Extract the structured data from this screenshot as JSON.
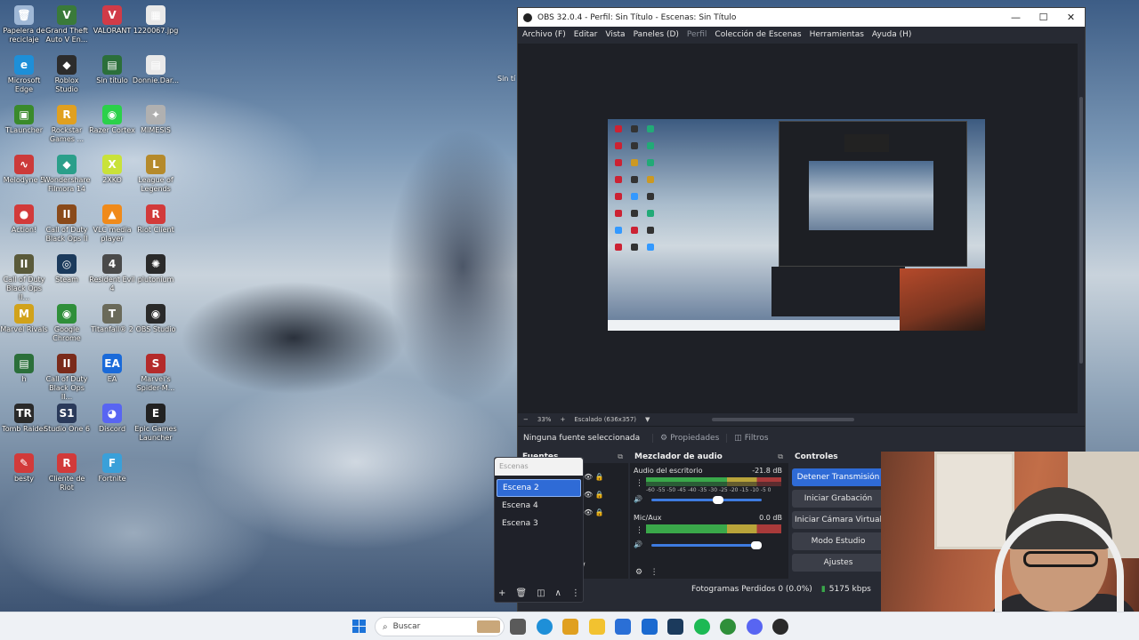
{
  "desktop": {
    "icons": [
      {
        "label": "Papelera de reciclaje",
        "color": "#9fb8d6",
        "glyph": "🗑"
      },
      {
        "label": "Grand Theft Auto V En...",
        "color": "#3a7a3a",
        "glyph": "V"
      },
      {
        "label": "VALORANT",
        "color": "#d13b48",
        "glyph": "V"
      },
      {
        "label": "1220067.jpg",
        "color": "#e9e9e9",
        "glyph": "▦"
      },
      {
        "label": "Microsoft Edge",
        "color": "#1e8fd8",
        "glyph": "e"
      },
      {
        "label": "Roblox Studio",
        "color": "#2c2c2c",
        "glyph": "◆"
      },
      {
        "label": "Sin título",
        "color": "#2b6f3a",
        "glyph": "▤"
      },
      {
        "label": "Donnie.Dar...",
        "color": "#e9e9e9",
        "glyph": "▤"
      },
      {
        "label": "TLauncher",
        "color": "#3a8a2b",
        "glyph": "▣"
      },
      {
        "label": "Rockstar Games ...",
        "color": "#e0a020",
        "glyph": "R"
      },
      {
        "label": "Razer Cortex",
        "color": "#2bd14a",
        "glyph": "◉"
      },
      {
        "label": "MIMESIS",
        "color": "#b0b0b0",
        "glyph": "✦"
      },
      {
        "label": "Melodyne 5",
        "color": "#cc3a3a",
        "glyph": "∿"
      },
      {
        "label": "Wondershare Filmora 14",
        "color": "#2b9f8a",
        "glyph": "◆"
      },
      {
        "label": "2XKO",
        "color": "#c9e23a",
        "glyph": "X"
      },
      {
        "label": "League of Legends",
        "color": "#b58a2b",
        "glyph": "L"
      },
      {
        "label": "Action!",
        "color": "#d23a3a",
        "glyph": "●"
      },
      {
        "label": "Call of Duty Black Ops II",
        "color": "#8a4a1a",
        "glyph": "II"
      },
      {
        "label": "VLC media player",
        "color": "#f08a1a",
        "glyph": "▲"
      },
      {
        "label": "Riot Client",
        "color": "#d23a3a",
        "glyph": "R"
      },
      {
        "label": "Call of Duty Black Ops II...",
        "color": "#5a5a3a",
        "glyph": "II"
      },
      {
        "label": "Steam",
        "color": "#1b3a5c",
        "glyph": "◎"
      },
      {
        "label": "Resident Evil 4",
        "color": "#4a4a4a",
        "glyph": "4"
      },
      {
        "label": "plutonium",
        "color": "#2a2a2a",
        "glyph": "✺"
      },
      {
        "label": "Marvel Rivals",
        "color": "#d1a21a",
        "glyph": "M"
      },
      {
        "label": "Google Chrome",
        "color": "#2f8f3a",
        "glyph": "◉"
      },
      {
        "label": "Titanfall® 2",
        "color": "#6a6a5a",
        "glyph": "T"
      },
      {
        "label": "OBS Studio",
        "color": "#2a2a2a",
        "glyph": "◉"
      },
      {
        "label": "h",
        "color": "#2b6f3a",
        "glyph": "▤"
      },
      {
        "label": "Call of Duty Black Ops II...",
        "color": "#7a2a1a",
        "glyph": "II"
      },
      {
        "label": "EA",
        "color": "#1a6ad9",
        "glyph": "EA"
      },
      {
        "label": "Marvel's Spider-M...",
        "color": "#b42a2a",
        "glyph": "S"
      },
      {
        "label": "Tomb Raider",
        "color": "#2a2a2a",
        "glyph": "TR"
      },
      {
        "label": "Studio One 6",
        "color": "#2a3a5a",
        "glyph": "S1"
      },
      {
        "label": "Discord",
        "color": "#5865f2",
        "glyph": "◕"
      },
      {
        "label": "Epic Games Launcher",
        "color": "#222222",
        "glyph": "E"
      },
      {
        "label": "besty",
        "color": "#d23a3a",
        "glyph": "✎"
      },
      {
        "label": "Cliente de Riot",
        "color": "#d23a3a",
        "glyph": "R"
      },
      {
        "label": "Fortnite",
        "color": "#3aa0d9",
        "glyph": "F"
      }
    ],
    "stray_label": "Sin tí"
  },
  "obs": {
    "title": "OBS 32.0.4 - Perfil: Sin Título - Escenas: Sin Título",
    "menu": [
      "Archivo (F)",
      "Editar",
      "Vista",
      "Paneles (D)",
      "Perfil",
      "Colección de Escenas",
      "Herramientas",
      "Ayuda (H)"
    ],
    "zoom": {
      "minus": "−",
      "percent": "33%",
      "plus": "+",
      "scale_label": "Escalado (636x357)"
    },
    "source_toolbar": {
      "no_source": "Ninguna fuente seleccionada",
      "properties": "Propiedades",
      "filters": "Filtros"
    },
    "docks": {
      "sources": "Fuentes",
      "mixer": "Mezclador de audio",
      "controls": "Controles"
    },
    "mixer": {
      "channels": [
        {
          "name": "Audio del escritorio",
          "db": "-21.8 dB",
          "level": 0.62
        },
        {
          "name": "Mic/Aux",
          "db": "0.0 dB",
          "level": 1.0
        }
      ],
      "scale": "-60 -55 -50 -45 -40 -35 -30 -25 -20 -15 -10 -5 0"
    },
    "controls": [
      "Detener Transmisión",
      "Iniciar Grabación",
      "Iniciar Cámara Virtual",
      "Modo Estudio",
      "Ajustes"
    ],
    "status": {
      "dropped": "Fotogramas Perdidos 0 (0.0%)",
      "bitrate": "5175 kbps",
      "extra": "0"
    },
    "scene_popup": {
      "title": "Escenas",
      "items": [
        "Escena 2",
        "Escena 4",
        "Escena 3"
      ],
      "selected": 0
    }
  },
  "taskbar": {
    "search_placeholder": "Buscar",
    "apps": [
      "file-explorer",
      "edge",
      "chrome-color",
      "folder",
      "store",
      "outlook",
      "steam",
      "spotify",
      "chrome",
      "discord",
      "obs"
    ]
  },
  "colors": {
    "accent": "#2f6bd6",
    "obs_bg": "#272a33",
    "dock_bg": "#1e2026"
  }
}
